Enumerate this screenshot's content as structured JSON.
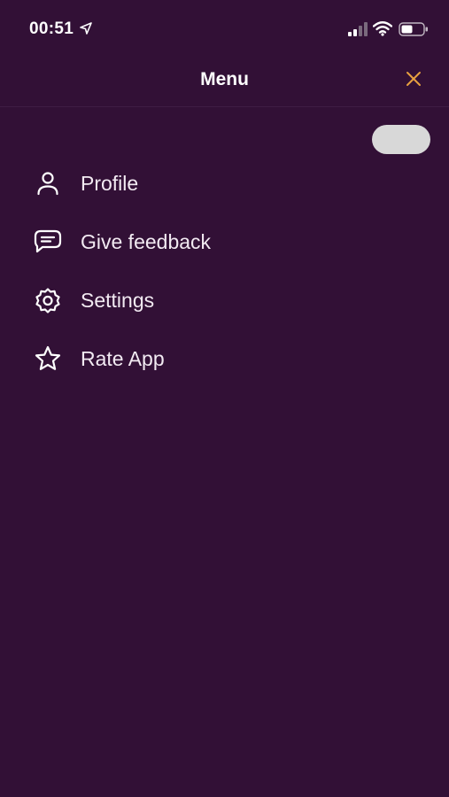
{
  "status_bar": {
    "time": "00:51",
    "icons": [
      "location-arrow-icon",
      "signal-icon",
      "wifi-icon",
      "battery-icon"
    ]
  },
  "header": {
    "title": "Menu",
    "close_icon": "close-icon"
  },
  "colors": {
    "background": "#321036",
    "accent": "#e8a040",
    "text": "#ffffff",
    "toggle": "#d8d8d8"
  },
  "menu": {
    "items": [
      {
        "label": "Profile",
        "icon": "person-icon"
      },
      {
        "label": "Give feedback",
        "icon": "chat-icon"
      },
      {
        "label": "Settings",
        "icon": "gear-icon"
      },
      {
        "label": "Rate App",
        "icon": "star-icon"
      }
    ]
  }
}
